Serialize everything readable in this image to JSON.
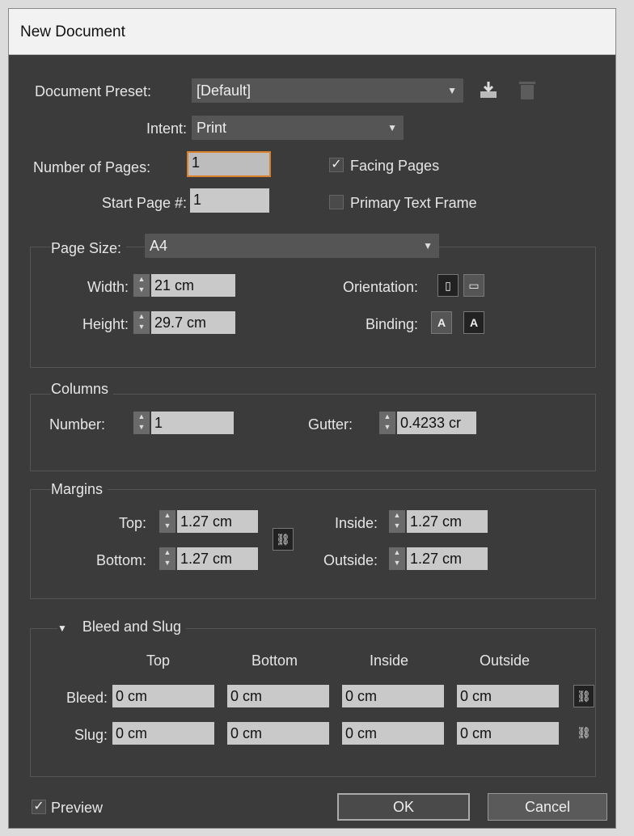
{
  "window": {
    "title": "New Document"
  },
  "document_preset": {
    "label": "Document Preset:",
    "value": "[Default]"
  },
  "intent": {
    "label": "Intent:",
    "value": "Print"
  },
  "num_pages": {
    "label": "Number of Pages:",
    "value": "1"
  },
  "start_page": {
    "label": "Start Page #:",
    "value": "1"
  },
  "facing_pages": {
    "label": "Facing Pages",
    "checked": true
  },
  "primary_text_frame": {
    "label": "Primary Text Frame",
    "checked": false
  },
  "page_size": {
    "label": "Page Size:",
    "value": "A4",
    "width_label": "Width:",
    "width": "21 cm",
    "height_label": "Height:",
    "height": "29.7 cm",
    "orientation_label": "Orientation:",
    "binding_label": "Binding:"
  },
  "columns": {
    "title": "Columns",
    "number_label": "Number:",
    "number": "1",
    "gutter_label": "Gutter:",
    "gutter": "0.4233 cr"
  },
  "margins": {
    "title": "Margins",
    "top_label": "Top:",
    "top": "1.27 cm",
    "bottom_label": "Bottom:",
    "bottom": "1.27 cm",
    "inside_label": "Inside:",
    "inside": "1.27 cm",
    "outside_label": "Outside:",
    "outside": "1.27 cm"
  },
  "bleed_slug": {
    "title": "Bleed and Slug",
    "headers": [
      "Top",
      "Bottom",
      "Inside",
      "Outside"
    ],
    "bleed_label": "Bleed:",
    "bleed": [
      "0 cm",
      "0 cm",
      "0 cm",
      "0 cm"
    ],
    "slug_label": "Slug:",
    "slug": [
      "0 cm",
      "0 cm",
      "0 cm",
      "0 cm"
    ]
  },
  "preview": {
    "label": "Preview",
    "checked": true
  },
  "buttons": {
    "ok": "OK",
    "cancel": "Cancel"
  }
}
